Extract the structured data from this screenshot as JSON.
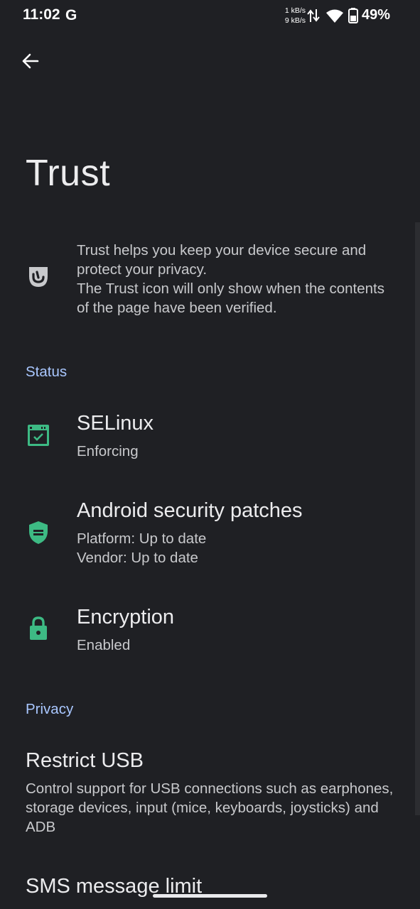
{
  "status_bar": {
    "time": "11:02",
    "g_glyph": "G",
    "speed_up": "1 kB/s",
    "speed_down": "9 kB/s",
    "battery": "49%",
    "icons": [
      "google-g-icon",
      "data-transfer-icon",
      "wifi-icon",
      "battery-icon"
    ]
  },
  "header": {
    "back_icon": "arrow-back-icon",
    "title": "Trust"
  },
  "intro": {
    "icon": "trust-shield-icon",
    "line1": "Trust helps you keep your device secure and protect your privacy.",
    "line2": "The Trust icon will only show when the contents of the page have been verified."
  },
  "sections": {
    "status": {
      "header": "Status",
      "items": [
        {
          "title": "SELinux",
          "subtitle": "Enforcing",
          "icon": "selinux-window-check-icon"
        },
        {
          "title": "Android security patches",
          "subtitle_line1": "Platform: Up to date",
          "subtitle_line2": "Vendor: Up to date",
          "icon": "shield-icon"
        },
        {
          "title": "Encryption",
          "subtitle": "Enabled",
          "icon": "lock-icon"
        }
      ]
    },
    "privacy": {
      "header": "Privacy",
      "items": [
        {
          "title": "Restrict USB",
          "subtitle": "Control support for USB connections such as earphones, storage devices, input (mice, keyboards, joysticks) and ADB"
        },
        {
          "title": "SMS message limit",
          "subtitle": ""
        }
      ]
    }
  },
  "colors": {
    "background": "#1f2024",
    "accent_header": "#a9c7ff",
    "status_ok_green": "#3dba84",
    "text_primary": "#ececee",
    "text_secondary": "#c8c9cc"
  }
}
